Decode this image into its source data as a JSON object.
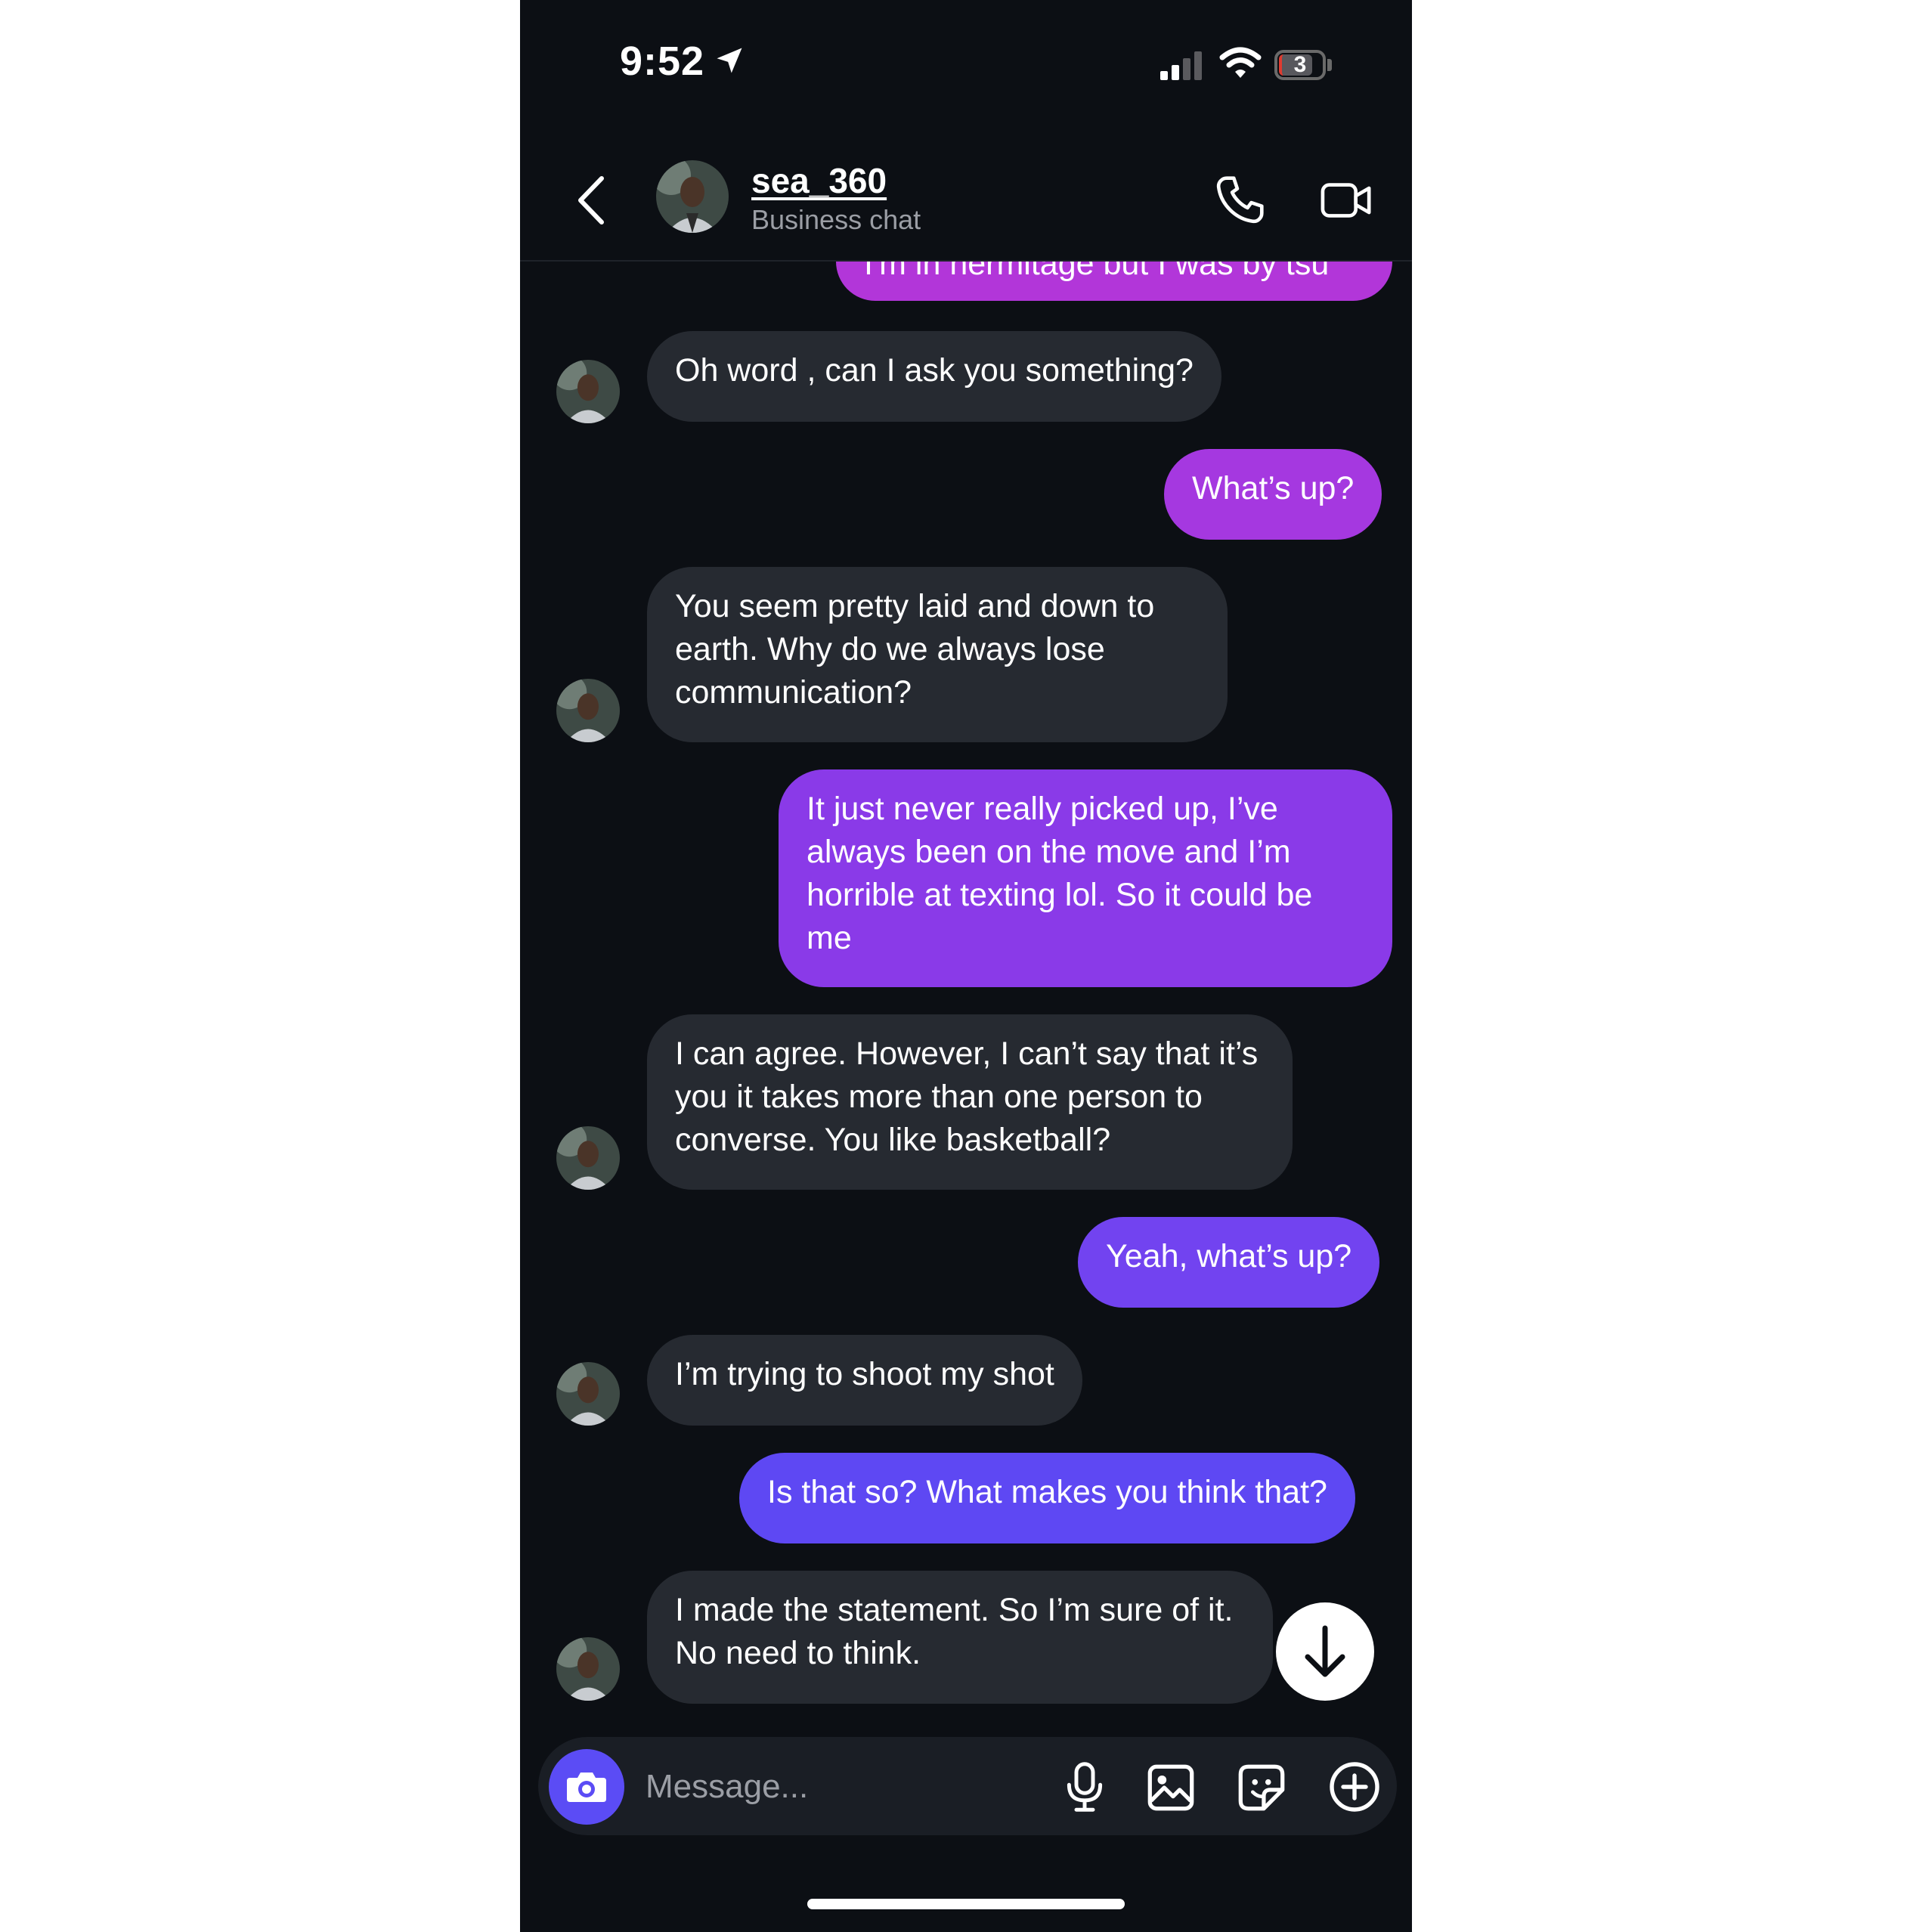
{
  "status_bar": {
    "time": "9:52",
    "battery": "3"
  },
  "header": {
    "name": "sea_360",
    "subtitle": "Business chat"
  },
  "messages": [
    {
      "side": "sent",
      "text": "I'm in hermitage but I was by tsu"
    },
    {
      "side": "received",
      "text": "Oh word , can I ask you something?"
    },
    {
      "side": "sent",
      "text": "What’s up?"
    },
    {
      "side": "received",
      "text": "You seem pretty laid and down to earth. Why do we always lose communication?"
    },
    {
      "side": "sent",
      "text": "It just never really picked up, I’ve always been on the move and I’m horrible at texting lol. So it could be me"
    },
    {
      "side": "received",
      "text": "I can agree. However, I can’t say that it’s you it takes more than one person to converse. You like basketball?"
    },
    {
      "side": "sent",
      "text": "Yeah, what’s up?"
    },
    {
      "side": "received",
      "text": "I’m trying to shoot my shot"
    },
    {
      "side": "sent",
      "text": "Is that so? What makes you think that?"
    },
    {
      "side": "received",
      "text": "I made the statement. So I’m sure of it. No need to think."
    }
  ],
  "composer": {
    "placeholder": "Message..."
  },
  "colors": {
    "background": "#0c0f14",
    "received_bubble": "#262a31",
    "sent_gradient_top": "#c43bd6",
    "sent_gradient_bottom": "#5b4cf5",
    "camera_button": "#5b4cf5"
  },
  "icons": [
    "location-arrow-icon",
    "signal-icon",
    "wifi-icon",
    "battery-icon",
    "back-chevron-icon",
    "phone-icon",
    "video-camera-icon",
    "arrow-down-icon",
    "camera-icon",
    "microphone-icon",
    "gallery-icon",
    "sticker-icon",
    "plus-circle-icon"
  ]
}
